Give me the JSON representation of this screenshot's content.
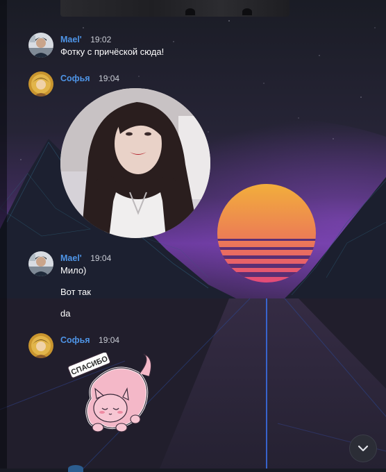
{
  "messages": [
    {
      "author": "Mael'",
      "time": "19:02",
      "lines": [
        "Фотку с причёской сюда!"
      ],
      "avatar_icon": "user-avatar-mael-icon"
    },
    {
      "author": "Софья",
      "time": "19:04",
      "attachment": "video-message",
      "avatar_icon": "user-avatar-sofya-icon"
    },
    {
      "author": "Mael'",
      "time": "19:04",
      "lines": [
        "Мило)",
        "Вот так",
        "da"
      ],
      "avatar_icon": "user-avatar-mael-icon"
    },
    {
      "author": "Софья",
      "time": "19:04",
      "attachment": "sticker",
      "sticker_text": "СПАСИБО",
      "avatar_icon": "user-avatar-sofya-icon"
    }
  ],
  "scroll_down": {
    "icon": "chevron-down-icon"
  },
  "colors": {
    "author_name": "#4e94e6",
    "message_text": "#ffffff",
    "timestamp": "#c9ccd4",
    "sun_top": "#f2b13a",
    "sun_bottom": "#e2487a",
    "sky_purple": "#6a3a9c"
  }
}
